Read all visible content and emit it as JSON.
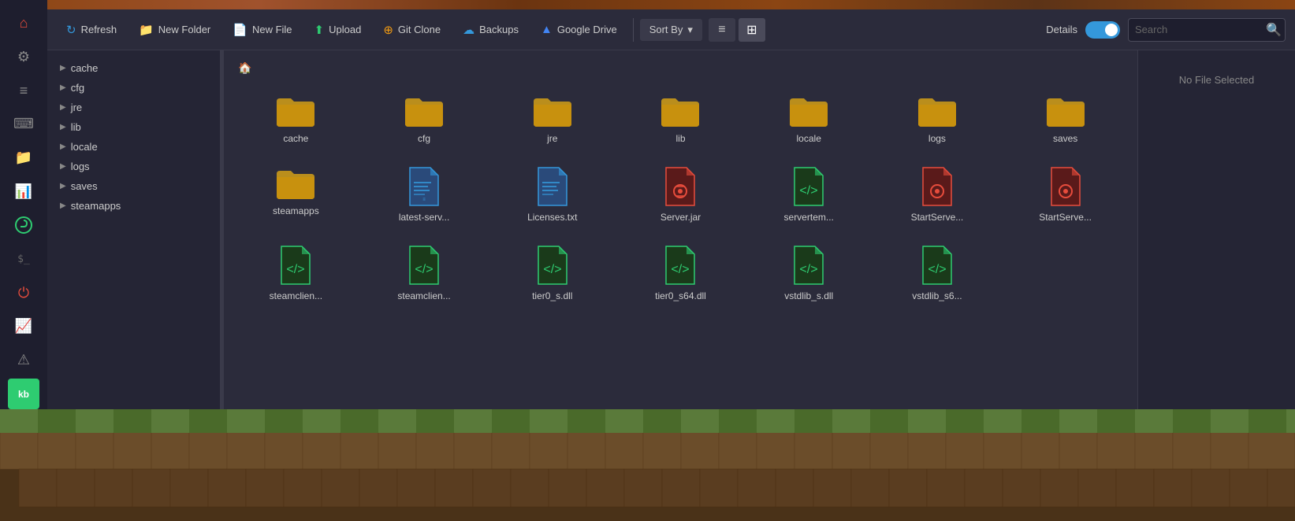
{
  "toolbar": {
    "refresh_label": "Refresh",
    "new_folder_label": "New Folder",
    "new_file_label": "New File",
    "upload_label": "Upload",
    "git_clone_label": "Git Clone",
    "backups_label": "Backups",
    "google_drive_label": "Google Drive",
    "sort_by_label": "Sort By",
    "details_label": "Details",
    "search_placeholder": "Search"
  },
  "tree_items": [
    {
      "label": "cache"
    },
    {
      "label": "cfg"
    },
    {
      "label": "jre"
    },
    {
      "label": "lib"
    },
    {
      "label": "locale"
    },
    {
      "label": "logs"
    },
    {
      "label": "saves"
    },
    {
      "label": "steamapps"
    }
  ],
  "files": [
    {
      "name": "cache",
      "type": "folder"
    },
    {
      "name": "cfg",
      "type": "folder"
    },
    {
      "name": "jre",
      "type": "folder"
    },
    {
      "name": "lib",
      "type": "folder"
    },
    {
      "name": "locale",
      "type": "folder"
    },
    {
      "name": "logs",
      "type": "folder"
    },
    {
      "name": "saves",
      "type": "folder"
    },
    {
      "name": "steamapps",
      "type": "folder"
    },
    {
      "name": "latest-serv...",
      "type": "doc-blue"
    },
    {
      "name": "Licenses.txt",
      "type": "doc-blue"
    },
    {
      "name": "Server.jar",
      "type": "doc-red"
    },
    {
      "name": "servertem...",
      "type": "doc-green"
    },
    {
      "name": "StartServe...",
      "type": "doc-red"
    },
    {
      "name": "StartServe...",
      "type": "doc-red"
    },
    {
      "name": "steamclien...",
      "type": "doc-green"
    },
    {
      "name": "steamclien...",
      "type": "doc-green"
    },
    {
      "name": "tier0_s.dll",
      "type": "doc-green"
    },
    {
      "name": "tier0_s64.dll",
      "type": "doc-green"
    },
    {
      "name": "vstdlib_s.dll",
      "type": "doc-green"
    },
    {
      "name": "vstdlib_s6...",
      "type": "doc-green"
    }
  ],
  "right_panel": {
    "no_file_label": "No File Selected"
  },
  "sidebar_icons": [
    {
      "name": "home-icon",
      "symbol": "⌂"
    },
    {
      "name": "settings-icon",
      "symbol": "⚙"
    },
    {
      "name": "sliders-icon",
      "symbol": "≡"
    },
    {
      "name": "keyboard-icon",
      "symbol": "⌨"
    },
    {
      "name": "folder-sidebar-icon",
      "symbol": "📁"
    },
    {
      "name": "chart-icon",
      "symbol": "📊"
    },
    {
      "name": "terminal-icon",
      "symbol": ">_"
    },
    {
      "name": "alert-icon",
      "symbol": "⚠"
    },
    {
      "name": "graph-icon",
      "symbol": "📈"
    }
  ]
}
